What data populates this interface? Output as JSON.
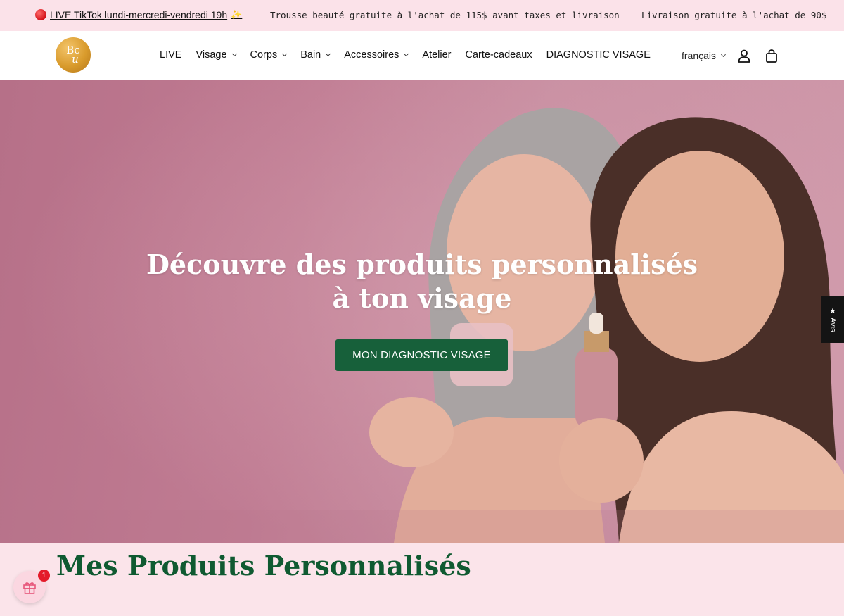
{
  "announcement": {
    "live_text": "LIVE TikTok lundi-mercredi-vendredi 19h",
    "live_emoji": "✨",
    "message_1": "Trousse beauté gratuite à l'achat de 115$ avant taxes et livraison",
    "message_2": "Livraison gratuite à l'achat de 90$"
  },
  "header": {
    "logo_line1": "Bc",
    "logo_line2": "u",
    "nav": [
      {
        "label": "LIVE",
        "dropdown": false
      },
      {
        "label": "Visage",
        "dropdown": true
      },
      {
        "label": "Corps",
        "dropdown": true
      },
      {
        "label": "Bain",
        "dropdown": true
      },
      {
        "label": "Accessoires",
        "dropdown": true
      },
      {
        "label": "Atelier",
        "dropdown": false
      },
      {
        "label": "Carte-cadeaux",
        "dropdown": false
      },
      {
        "label": "DIAGNOSTIC VISAGE",
        "dropdown": false
      }
    ],
    "language": "français",
    "icons": {
      "account": "user-icon",
      "cart": "shopping-bag-icon"
    }
  },
  "hero": {
    "title": "Découvre des produits personnalisés à ton visage",
    "cta_label": "MON DIAGNOSTIC VISAGE"
  },
  "reviews_tab": {
    "star": "★",
    "label": "Avis"
  },
  "section": {
    "title": "Mes Produits Personnalisés"
  },
  "rewards": {
    "icon": "gift-icon",
    "badge_count": "1"
  },
  "colors": {
    "announcement_bg": "#fbe2e9",
    "cta_green": "#17603a",
    "section_title_green": "#0f5a31",
    "hero_pink": "#c07c93"
  }
}
